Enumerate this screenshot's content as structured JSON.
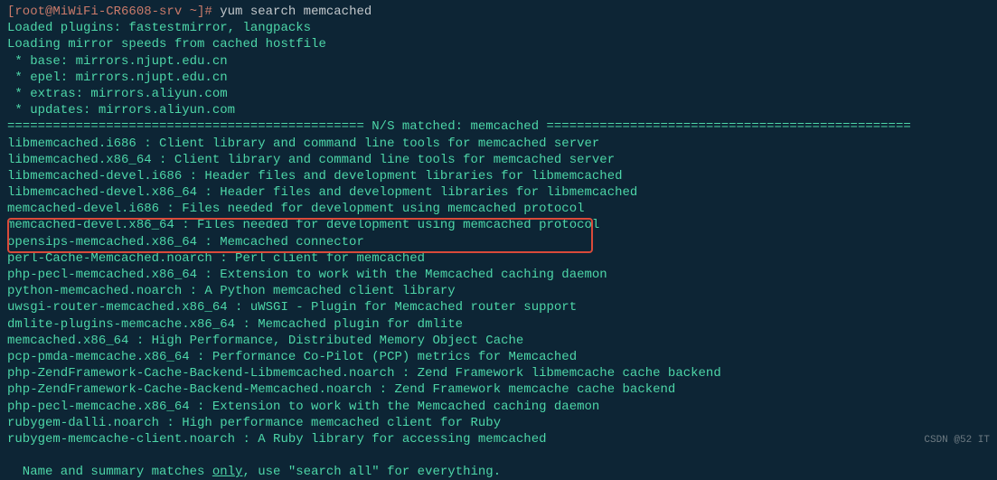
{
  "prompt": {
    "user_host": "[root@MiWiFi-CR6608-srv ~]#",
    "command": "yum search memcached"
  },
  "output": {
    "plugins": "Loaded plugins: fastestmirror, langpacks",
    "loading": "Loading mirror speeds from cached hostfile",
    "mirrors": [
      " * base: mirrors.njupt.edu.cn",
      " * epel: mirrors.njupt.edu.cn",
      " * extras: mirrors.aliyun.com",
      " * updates: mirrors.aliyun.com"
    ],
    "match_header_left": "=============================================== N/S matched: memcached ",
    "match_header_right": "================================================",
    "results": [
      "libmemcached.i686 : Client library and command line tools for memcached server",
      "libmemcached.x86_64 : Client library and command line tools for memcached server",
      "libmemcached-devel.i686 : Header files and development libraries for libmemcached",
      "libmemcached-devel.x86_64 : Header files and development libraries for libmemcached",
      "memcached-devel.i686 : Files needed for development using memcached protocol",
      "memcached-devel.x86_64 : Files needed for development using memcached protocol",
      "opensips-memcached.x86_64 : Memcached connector",
      "perl-Cache-Memcached.noarch : Perl client for memcached",
      "php-pecl-memcached.x86_64 : Extension to work with the Memcached caching daemon",
      "python-memcached.noarch : A Python memcached client library",
      "uwsgi-router-memcached.x86_64 : uWSGI - Plugin for Memcached router support",
      "dmlite-plugins-memcache.x86_64 : Memcached plugin for dmlite",
      "memcached.x86_64 : High Performance, Distributed Memory Object Cache",
      "pcp-pmda-memcache.x86_64 : Performance Co-Pilot (PCP) metrics for Memcached",
      "php-ZendFramework-Cache-Backend-Libmemcached.noarch : Zend Framework libmemcache cache backend",
      "php-ZendFramework-Cache-Backend-Memcached.noarch : Zend Framework memcache cache backend",
      "php-pecl-memcache.x86_64 : Extension to work with the Memcached caching daemon",
      "rubygem-dalli.noarch : High performance memcached client for Ruby",
      "rubygem-memcache-client.noarch : A Ruby library for accessing memcached"
    ],
    "footer_pre": "  Name and summary matches ",
    "footer_only": "only",
    "footer_post": ", use \"search all\" for everything."
  },
  "watermark": "CSDN @52 IT"
}
